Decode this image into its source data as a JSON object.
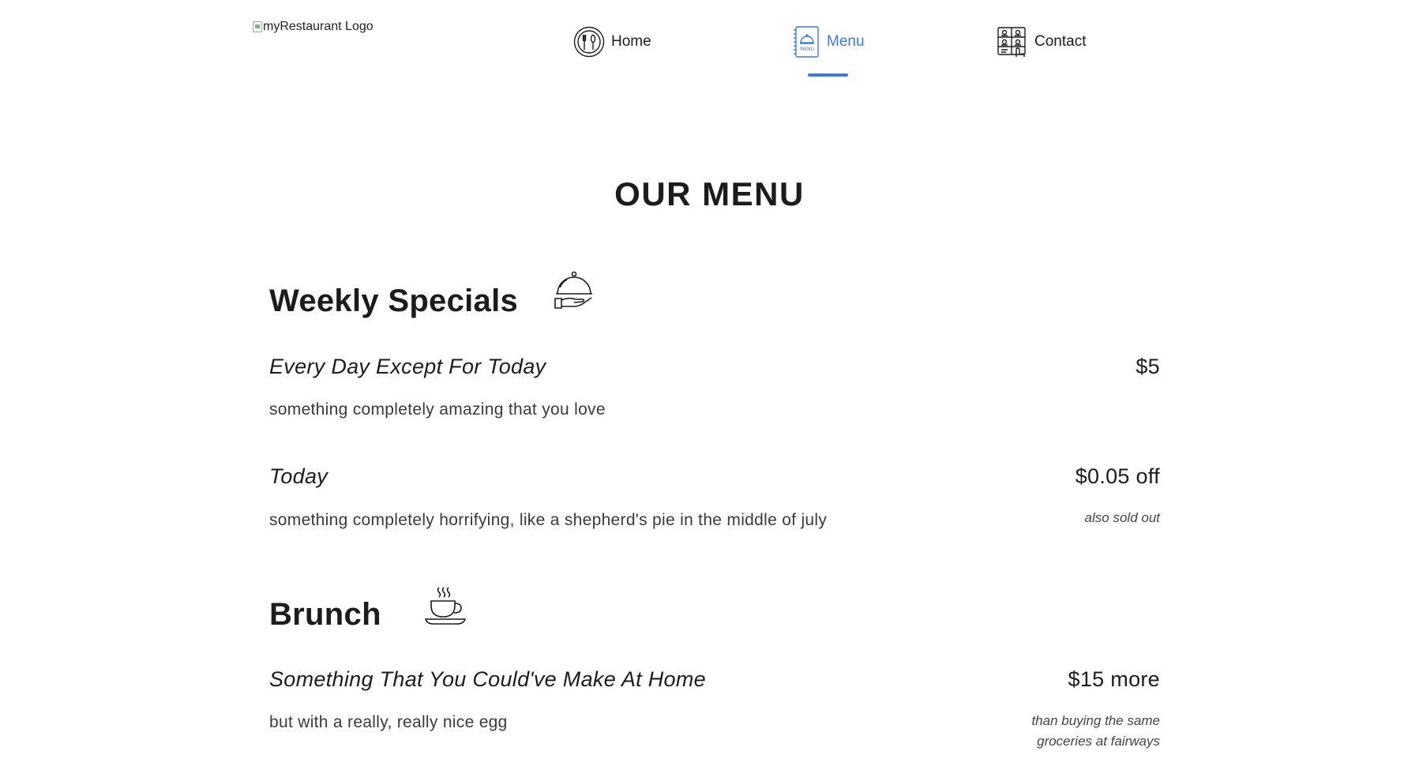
{
  "header": {
    "logo_alt": "myRestaurant Logo",
    "nav": [
      {
        "label": "Home",
        "icon": "plate-cutlery-icon",
        "active": false
      },
      {
        "label": "Menu",
        "icon": "menu-book-icon",
        "active": true
      },
      {
        "label": "Contact",
        "icon": "contact-directory-icon",
        "active": false
      }
    ],
    "active_color": "#3f7bd6"
  },
  "main": {
    "title": "OUR MENU",
    "sections": [
      {
        "title": "Weekly Specials",
        "icon": "cloche-serving-icon",
        "items": [
          {
            "name": "Every Day Except For Today",
            "price": "$5",
            "description": "something completely amazing that you love",
            "note": ""
          },
          {
            "name": "Today",
            "price": "$0.05 off",
            "description": "something completely horrifying, like a shepherd's pie in the middle of july",
            "note": "also sold out"
          }
        ]
      },
      {
        "title": "Brunch",
        "icon": "coffee-cup-icon",
        "items": [
          {
            "name": "Something That You Could've Make At Home",
            "price": "$15 more",
            "description": "but with a really, really nice egg",
            "note": "than buying the same groceries at fairways"
          }
        ]
      }
    ]
  }
}
